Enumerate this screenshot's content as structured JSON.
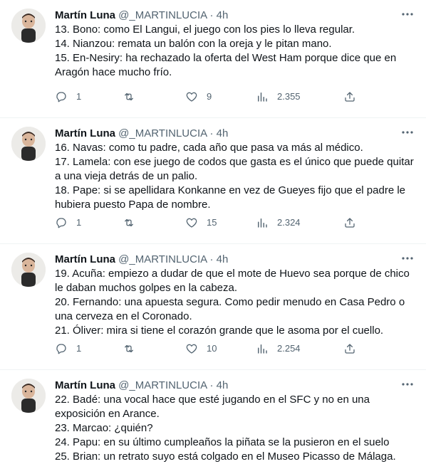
{
  "tweets": [
    {
      "name": "Martín Luna",
      "handle": "@_MARTINLUCIA",
      "sep": "·",
      "time": "4h",
      "lines": [
        "13. Bono: como El Langui, el juego con los pies lo lleva regular.",
        "14. Nianzou: remata un balón con la oreja y le pitan mano.",
        "15. En-Nesiry: ha rechazado la oferta del West Ham porque dice que en",
        "Aragón hace mucho frío."
      ],
      "replies": "1",
      "retweets": "",
      "likes": "9",
      "views": "2.355"
    },
    {
      "name": "Martín Luna",
      "handle": "@_MARTINLUCIA",
      "sep": "·",
      "time": "4h",
      "lines": [
        "16. Navas: como tu padre, cada año que pasa va más al médico.",
        "17. Lamela: con ese juego de codos que gasta es el único que puede quitar",
        "a una vieja detrás de un palio.",
        "18. Pape: si se apellidara Konkanne en vez de Gueyes fijo que el padre le",
        "hubiera puesto Papa de nombre."
      ],
      "replies": "1",
      "retweets": "",
      "likes": "15",
      "views": "2.324"
    },
    {
      "name": "Martín Luna",
      "handle": "@_MARTINLUCIA",
      "sep": "·",
      "time": "4h",
      "lines": [
        "19. Acuña: empiezo a dudar de que el mote de Huevo sea porque de chico",
        "le daban muchos golpes en la cabeza.",
        "20. Fernando: una apuesta segura. Como pedir menudo en Casa Pedro o",
        "una cerveza en el Coronado.",
        "21. Óliver: mira si tiene el corazón grande que le asoma por el cuello."
      ],
      "replies": "1",
      "retweets": "",
      "likes": "10",
      "views": "2.254"
    },
    {
      "name": "Martín Luna",
      "handle": "@_MARTINLUCIA",
      "sep": "·",
      "time": "4h",
      "lines": [
        "22. Badé: una vocal hace que esté jugando en el SFC y no en una",
        "exposición en Arance.",
        "23. Marcao: ¿quién?",
        "24. Papu: en su último cumpleaños la piñata se la pusieron en el suelo",
        "25. Brian: un retrato suyo está colgado en el Museo Picasso de Málaga."
      ],
      "replies": "",
      "retweets": "",
      "likes": "",
      "views": ""
    }
  ],
  "icons": {
    "more": "more-horizontal-icon",
    "reply": "reply-icon",
    "retweet": "retweet-icon",
    "like": "heart-icon",
    "views": "views-chart-icon",
    "share": "share-icon"
  },
  "colors": {
    "text": "#0f1419",
    "secondary": "#536471",
    "divider": "#eff3f4"
  }
}
